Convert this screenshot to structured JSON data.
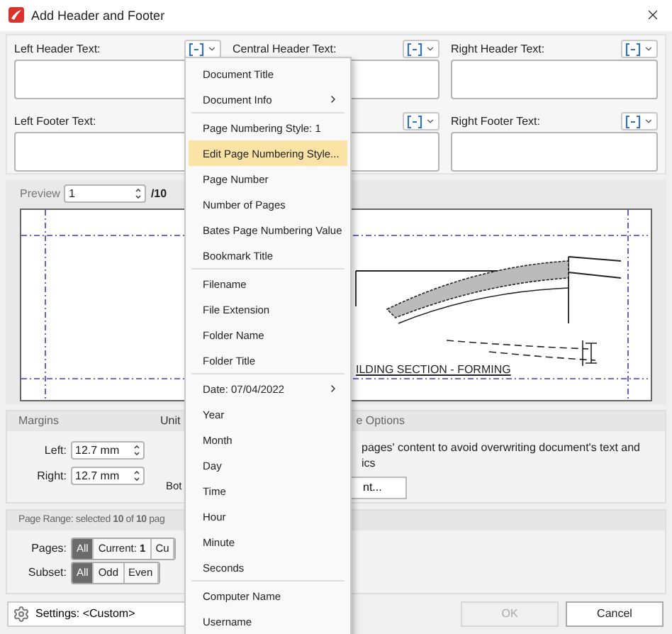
{
  "window": {
    "title": "Add Header and Footer"
  },
  "header_fields": [
    {
      "kind": "full",
      "label": "Left Header Text:"
    },
    {
      "kind": "full",
      "label": "Central Header Text:"
    },
    {
      "kind": "full",
      "label": "Right Header Text:"
    }
  ],
  "footer_fields": [
    {
      "kind": "label_only",
      "label": "Left Footer Text:"
    },
    {
      "kind": "button_only"
    },
    {
      "kind": "full",
      "label": "Right Footer Text:"
    }
  ],
  "preview": {
    "label": "Preview",
    "page": "1",
    "total": "/10",
    "caption": "ILDING SECTION - FORMING"
  },
  "margins": {
    "title": "Margins",
    "unit_label": "Unit",
    "fields": [
      {
        "label": "Left:",
        "value": "12.7 mm"
      },
      {
        "label": "Right:",
        "value": "12.7 mm"
      }
    ],
    "bottom_label": "Bot"
  },
  "options": {
    "title": "e Options",
    "lines": [
      "pages' content to avoid overwriting document's text and",
      "ics"
    ],
    "button": "nt..."
  },
  "page_range": {
    "title": "Page Range: selected **10** of **10** pag",
    "pages": {
      "label": "Pages:",
      "options": [
        {
          "label": "All",
          "selected": true
        },
        {
          "label": "Current: **1**",
          "selected": false
        },
        {
          "label": "Cu",
          "selected": false
        }
      ]
    },
    "subset": {
      "label": "Subset:",
      "options": [
        {
          "label": "All",
          "selected": true
        },
        {
          "label": "Odd",
          "selected": false
        },
        {
          "label": "Even",
          "selected": false
        }
      ]
    }
  },
  "settings": {
    "text": "Settings:  <Custom>"
  },
  "buttons": [
    {
      "label": "OK",
      "disabled": true
    },
    {
      "label": "Cancel",
      "disabled": false
    }
  ],
  "menu": {
    "items": [
      {
        "kind": "item",
        "label": "Document Title",
        "selected": false,
        "submenu": false
      },
      {
        "kind": "item",
        "label": "Document Info",
        "selected": false,
        "submenu": true
      },
      {
        "kind": "separator"
      },
      {
        "kind": "item",
        "label": "Page Numbering Style: 1",
        "selected": false,
        "submenu": false
      },
      {
        "kind": "item",
        "label": "Edit Page Numbering Style...",
        "selected": true,
        "submenu": false
      },
      {
        "kind": "item",
        "label": "Page Number",
        "selected": false,
        "submenu": false
      },
      {
        "kind": "item",
        "label": "Number of Pages",
        "selected": false,
        "submenu": false
      },
      {
        "kind": "item",
        "label": "Bates Page Numbering Value",
        "selected": false,
        "submenu": false
      },
      {
        "kind": "item",
        "label": "Bookmark Title",
        "selected": false,
        "submenu": false
      },
      {
        "kind": "separator"
      },
      {
        "kind": "item",
        "label": "Filename",
        "selected": false,
        "submenu": false
      },
      {
        "kind": "item",
        "label": "File Extension",
        "selected": false,
        "submenu": false
      },
      {
        "kind": "item",
        "label": "Folder Name",
        "selected": false,
        "submenu": false
      },
      {
        "kind": "item",
        "label": "Folder Title",
        "selected": false,
        "submenu": false
      },
      {
        "kind": "separator"
      },
      {
        "kind": "item",
        "label": "Date: 07/04/2022",
        "selected": false,
        "submenu": true
      },
      {
        "kind": "item",
        "label": "Year",
        "selected": false,
        "submenu": false
      },
      {
        "kind": "item",
        "label": "Month",
        "selected": false,
        "submenu": false
      },
      {
        "kind": "item",
        "label": "Day",
        "selected": false,
        "submenu": false
      },
      {
        "kind": "item",
        "label": "Time",
        "selected": false,
        "submenu": false
      },
      {
        "kind": "item",
        "label": "Hour",
        "selected": false,
        "submenu": false
      },
      {
        "kind": "item",
        "label": "Minute",
        "selected": false,
        "submenu": false
      },
      {
        "kind": "item",
        "label": "Seconds",
        "selected": false,
        "submenu": false
      },
      {
        "kind": "separator"
      },
      {
        "kind": "item",
        "label": "Computer Name",
        "selected": false,
        "submenu": false
      },
      {
        "kind": "item",
        "label": "Username",
        "selected": false,
        "submenu": false
      }
    ]
  }
}
